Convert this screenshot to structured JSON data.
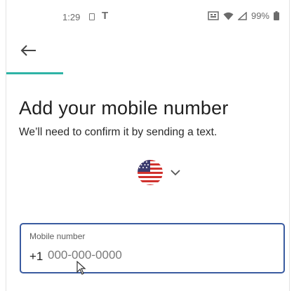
{
  "status_bar": {
    "time": "1:29",
    "battery_percent": "99%",
    "icons": [
      "sim-card-icon",
      "t-mobile-icon",
      "cast-icon",
      "wifi-icon",
      "signal-icon",
      "battery-icon"
    ]
  },
  "header": {
    "back_icon": "arrow-left-icon"
  },
  "progress": {
    "fraction": 0.2,
    "color": "#2fb4a6"
  },
  "content": {
    "title": "Add your mobile number",
    "subtitle": "We’ll need to confirm it by sending a text."
  },
  "country_picker": {
    "flag_icon": "us-flag-icon",
    "chevron_icon": "chevron-down-icon"
  },
  "phone_field": {
    "label": "Mobile number",
    "prefix": "+1",
    "value": "",
    "placeholder": "000-000-0000",
    "border_color": "#3a5ba0"
  },
  "accent_color": "#2fb4a6"
}
